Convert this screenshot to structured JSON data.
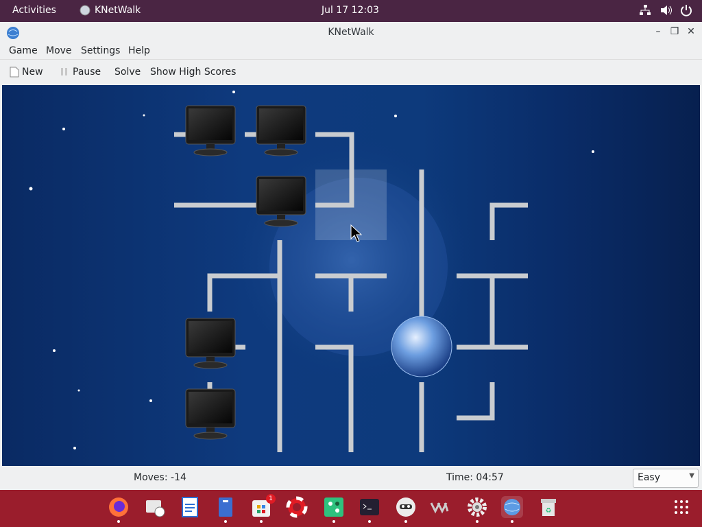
{
  "topbar": {
    "activities": "Activities",
    "app_name": "KNetWalk",
    "clock": "Jul 17  12:03"
  },
  "window": {
    "title": "KNetWalk",
    "icon": "knetwalk-globe-icon"
  },
  "menu": {
    "game": "Game",
    "move": "Move",
    "settings": "Settings",
    "help": "Help"
  },
  "toolbar": {
    "new": "New",
    "pause": "Pause",
    "solve": "Solve",
    "high_scores": "Show High Scores"
  },
  "status": {
    "moves": "Moves: -14",
    "time": "Time: 04:57",
    "difficulty": "Easy"
  },
  "dock": {
    "badge_count": "1",
    "apps": [
      "firefox-icon",
      "mail-clock-icon",
      "writer-icon",
      "file-manager-icon",
      "software-icon",
      "help-lifebuoy-icon",
      "game-icon",
      "terminal-icon",
      "robot-icon",
      "vm-icon",
      "settings-gear-icon",
      "knetwalk-icon",
      "trash-icon"
    ]
  },
  "colors": {
    "topbar": "#4a2543",
    "dock": "#9a1d2c",
    "board": "#0e3a7e"
  }
}
